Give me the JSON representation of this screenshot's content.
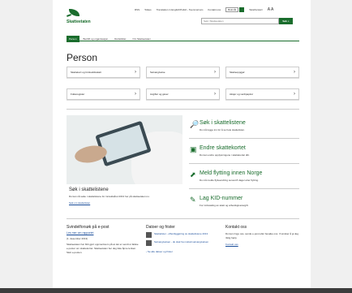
{
  "brand": {
    "name": "Skatteetaten"
  },
  "toplinks": [
    "RSS",
    "Tolkes",
    "Translation in English/Polish - Teenmornam",
    "Kontakt oss"
  ],
  "language": {
    "selected": "Bokmål"
  },
  "print": "Tekstforstørr",
  "font_size_label": "A A",
  "search": {
    "placeholder": "Søk i Skatteetaten",
    "button": "Søk"
  },
  "nav": [
    "Person",
    "Bedrift og organisasjon",
    "Rettskilder",
    "Om Skatteetaten"
  ],
  "page": {
    "title": "Person"
  },
  "tiles": [
    {
      "label": "Skattekort og forskuddsskatt"
    },
    {
      "label": "Selvangivelse"
    },
    {
      "label": "Skatteoppgjør"
    },
    {
      "label": "Folkeregister"
    },
    {
      "label": "Avgifter og gaver"
    },
    {
      "label": "Aksjer og verdipapirer"
    }
  ],
  "hero": {
    "title": "Søk i skattelistene",
    "body": "Du kan nå søke i skattelistene for inntektsåret 2013 her på skatteetaten.no.",
    "link": "Søk om skattelisten"
  },
  "promos": [
    {
      "title": "Søk i skattelistene",
      "body": "Du må logge inn for å se hele skattelisten.",
      "icon": "🔎"
    },
    {
      "title": "Endre skattekortet",
      "body": "Du kan endre opplysningene i skattekortet ditt.",
      "icon": "▣"
    },
    {
      "title": "Meld flytting innen Norge",
      "body": "Du må melde flytteendring senest 8 dager etter flytting.",
      "icon": "⬈"
    },
    {
      "title": "Lag KID-nummer",
      "body": "For innbetaling av skatt og arbeidsgiveravgift.",
      "icon": "✎"
    }
  ],
  "footer_cols": {
    "warning": {
      "title": "Svindelforsøk på e-post",
      "link": "Les mer om rapportet",
      "date": "(1. desember 2013)",
      "text": "Skatteetaten har blitt gjort oppmerksom på at det er sendt ut falske e-poster om skattekortet. Skatteetaten ber deg ikke åpne lenken. Slett e-posten."
    },
    "news": {
      "title": "Datoer og frister",
      "items": [
        "Skattelister - offentliggjøring av skattelistene 2013",
        "Selvangivelsen - du skal ha mottatt selvangivelsen"
      ],
      "more": "› Se alle datoer og frister"
    },
    "contact": {
      "title": "Kontakt oss",
      "text": "Du kan ringe oss, sende e-post eller besøke oss. Vi ønsker å gi deg riktig hjelp.",
      "link": "Kontakt oss"
    }
  },
  "colors": {
    "brand": "#1a6d2d",
    "link": "#1a4d9a",
    "footer": "#3c3c3c"
  }
}
